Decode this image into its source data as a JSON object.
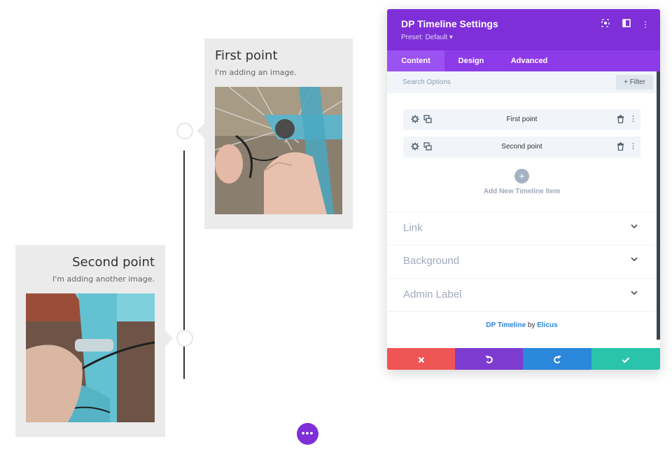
{
  "timeline": {
    "items": [
      {
        "title": "First point",
        "text": "I'm adding an image."
      },
      {
        "title": "Second point",
        "text": "I'm adding another image."
      }
    ]
  },
  "panel": {
    "title": "DP Timeline Settings",
    "preset": "Preset: Default ▾",
    "header_icons": [
      "focus-icon",
      "split-view-icon",
      "kebab-menu-icon"
    ],
    "tabs": [
      {
        "label": "Content",
        "active": true
      },
      {
        "label": "Design",
        "active": false
      },
      {
        "label": "Advanced",
        "active": false
      }
    ],
    "search": {
      "placeholder": "Search Options"
    },
    "filter_label": "+ Filter",
    "items": [
      {
        "label": "First point"
      },
      {
        "label": "Second point"
      }
    ],
    "add_item_label": "Add New Timeline Item",
    "sections": [
      {
        "label": "Link"
      },
      {
        "label": "Background"
      },
      {
        "label": "Admin Label"
      }
    ],
    "credit": {
      "module": "DP Timeline",
      "by": "by",
      "author": "Elicus"
    },
    "footer": {
      "cancel_color": "#ef5555",
      "undo_color": "#7e3bd0",
      "redo_color": "#2b87da",
      "save_color": "#29c4a9"
    }
  },
  "colors": {
    "accent": "#7e2fd8",
    "tabs_bg": "#8d3be8"
  }
}
